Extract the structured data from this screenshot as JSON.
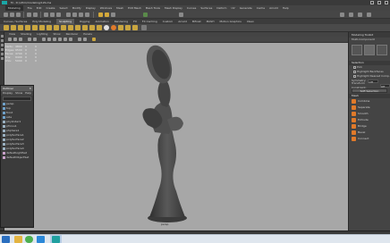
{
  "window": {
    "title": "M - D:/uthm/modeling/12b.ma",
    "app_icon": "maya-logo-icon"
  },
  "menubar": {
    "items": [
      "File",
      "Edit",
      "Create",
      "Select",
      "Modify",
      "Display",
      "Windows",
      "Mesh",
      "Edit Mesh",
      "Mesh Tools",
      "Mesh Display",
      "Curves",
      "Surfaces",
      "Deform",
      "UV",
      "Generate",
      "Cache",
      "Arnold",
      "Help"
    ],
    "mode": "Modeling"
  },
  "shelf_tabs": {
    "items": [
      "Curves / Surfaces",
      "Poly Modeling",
      "Sculpting",
      "Rigging",
      "Animation",
      "Rendering",
      "FX",
      "FX Caching",
      "Custom",
      "Arnold",
      "Bifrost",
      "MASH",
      "Motion Graphics",
      "XGen"
    ],
    "active": "Sculpting"
  },
  "panel_menu": {
    "items": [
      "View",
      "Shading",
      "Lighting",
      "Show",
      "Renderer",
      "Panels"
    ]
  },
  "hud": {
    "rows": [
      [
        "Verts:",
        "4800",
        "0",
        "0"
      ],
      [
        "Edges:",
        "9500",
        "0",
        "0"
      ],
      [
        "Faces:",
        "4700",
        "0",
        "0"
      ],
      [
        "Tris:",
        "9400",
        "0",
        "0"
      ],
      [
        "UVs:",
        "5000",
        "0",
        "0"
      ]
    ]
  },
  "viewport": {
    "camera_label": "persp",
    "background_color": "#a7a7a7",
    "model_color": "#4a4a4a"
  },
  "outliner": {
    "title": "Outliner",
    "menu": [
      "Display",
      "Show",
      "Help"
    ],
    "items": [
      "persp",
      "top",
      "front",
      "side",
      "pCylinder1",
      "pTorus1",
      "pSphere1",
      "polySurface1",
      "polySurface2",
      "polySurface3",
      "polySurface4",
      "defaultLightSet",
      "defaultObjectSet"
    ]
  },
  "tool_settings": {
    "title": "Modeling Toolkit",
    "mode_label": "Multi-Component",
    "selection_section": "Selection",
    "options": [
      "Pick",
      "Highlight Backfaces",
      "Highlight Nearest Comp."
    ],
    "fields": [
      {
        "label": "Symmetry:",
        "value": "Off"
      },
      {
        "label": "Transform Constraint:",
        "value": "Off"
      }
    ],
    "soft_select_button": "Soft Selection",
    "mesh_section": "Mesh",
    "tools": [
      "Combine",
      "Separate",
      "Smooth",
      "Extrude",
      "Bridge",
      "Bevel",
      "Connect"
    ]
  },
  "taskbar": {
    "items": [
      "start-icon",
      "file-explorer-icon",
      "chrome-icon",
      "edge-icon",
      "mail-icon",
      "maya-icon"
    ]
  }
}
